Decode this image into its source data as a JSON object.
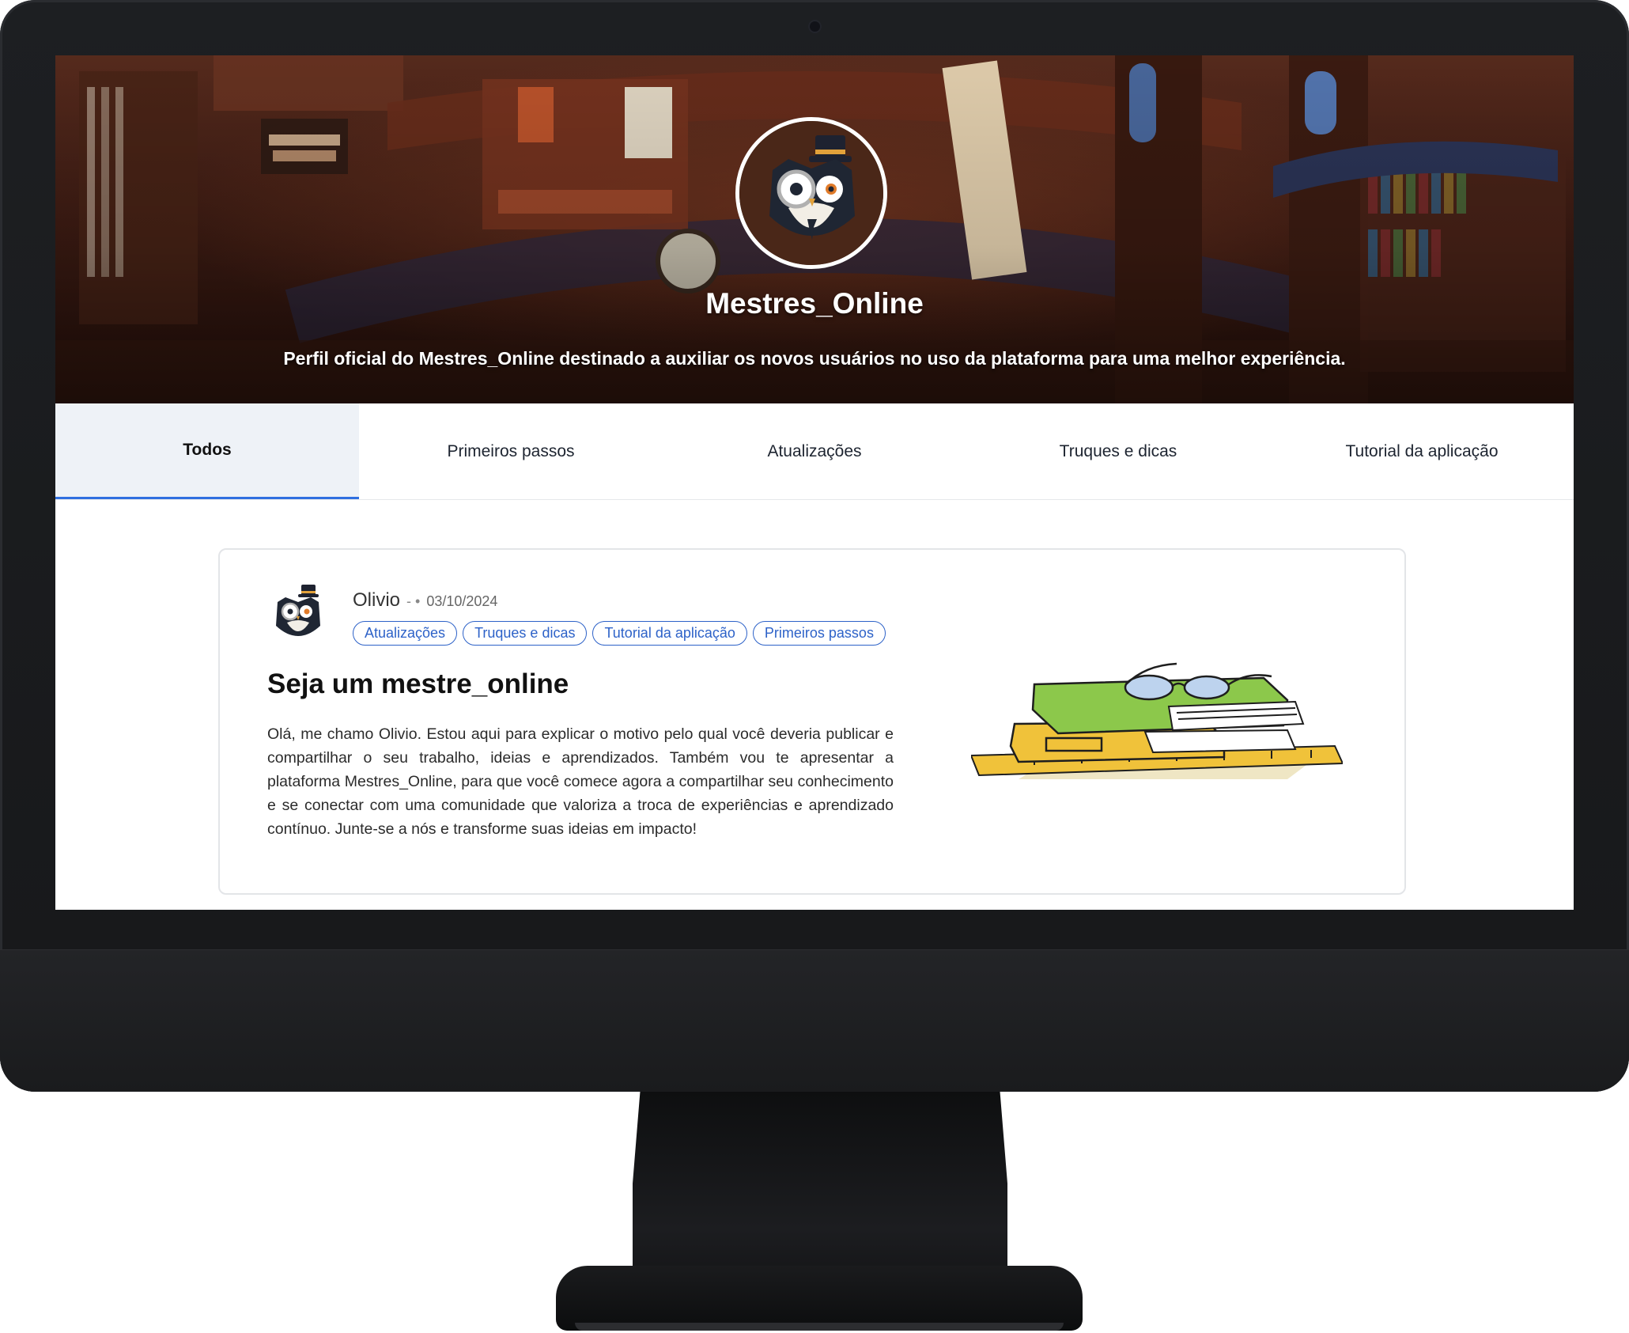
{
  "profile": {
    "name": "Mestres_Online",
    "description": "Perfil oficial do Mestres_Online destinado a auxiliar os novos usuários no uso da plataforma para uma melhor experiência."
  },
  "tabs": [
    {
      "label": "Todos",
      "active": true
    },
    {
      "label": "Primeiros passos",
      "active": false
    },
    {
      "label": "Atualizações",
      "active": false
    },
    {
      "label": "Truques e dicas",
      "active": false
    },
    {
      "label": "Tutorial da aplicação",
      "active": false
    }
  ],
  "post": {
    "author": "Olivio",
    "separator": "- •",
    "date": "03/10/2024",
    "tags": [
      "Atualizações",
      "Truques e dicas",
      "Tutorial da aplicação",
      "Primeiros passos"
    ],
    "title": "Seja um mestre_online",
    "body": "Olá, me chamo Olivio. Estou aqui para explicar o motivo pelo qual você deveria publicar e compartilhar o seu trabalho, ideias e aprendizados. Também vou te apresentar a plataforma Mestres_Online, para que você comece agora a compartilhar seu conhecimento e se conectar com uma comunidade que valoriza a troca de experiências e aprendizado contínuo. Junte-se a nós e transforme suas ideias em impacto!"
  },
  "icons": {
    "profile_avatar": "owl-mascot-icon",
    "author_avatar": "owl-mascot-icon",
    "illustration": "books-with-glasses-illustration"
  },
  "colors": {
    "accent": "#2f6fe0",
    "chip": "#2d62c8",
    "active_tab_bg": "#eef2f7"
  }
}
